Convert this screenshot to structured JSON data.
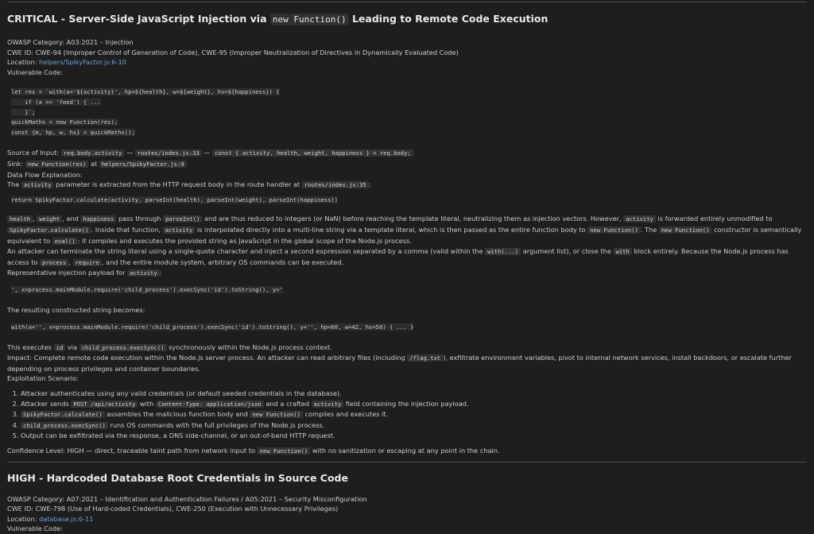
{
  "c": {
    "h_a": "CRITICAL - Server-Side JavaScript Injection via",
    "h_code": "new Function()",
    "h_b": "Leading to Remote Code Execution",
    "owasp": "OWASP Category: A03:2021 – Injection",
    "cwe": "CWE ID: CWE-94 (Improper Control of Generation of Code), CWE-95 (Improper Neutralization of Directives in Dynamically Evaluated Code)",
    "loc_label": "Location:",
    "loc_link": "helpers/SpikyFactor.js:6-10",
    "vuln_label": "Vulnerable Code:",
    "code1": [
      "let res = `with(a='${activity}', hp=${health}, w=${weight}, hs=${happiness}) {",
      "    if (a == 'feed') { ...",
      "    }`;",
      "quickMaths = new Function(res);",
      "const {m, hp, w, hs} = quickMaths();"
    ],
    "src_label": "Source of Input:",
    "src_c1": "req.body.activity",
    "src_sep1": "—",
    "src_c2": "routes/index.js:33",
    "src_sep2": "—",
    "src_c3": "const { activity, health, weight, happiness } = req.body;",
    "sink_label": "Sink:",
    "sink_c1": "new Function(res)",
    "sink_at": "at",
    "sink_c2": "helpers/SpikyFactor.js:9",
    "dfe_label": "Data Flow Explanation:",
    "dfe_a": "The",
    "dfe_c1": "activity",
    "dfe_b": "parameter is extracted from the HTTP request body in the route handler at",
    "dfe_c2": "routes/index.js:35",
    "dfe_end": ":",
    "code2": "return SpikyFactor.calculate(activity, parseInt(health), parseInt(weight), parseInt(happiness))",
    "para1": {
      "c1": "health",
      "t1": ",",
      "c2": "weight",
      "t2": ", and",
      "c3": "happiness",
      "t3": "pass through",
      "c4": "parseInt()",
      "t4": "and are thus reduced to integers (or NaN) before reaching the template literal, neutralizing them as injection vectors. However,",
      "c5": "activity",
      "t5": "is forwarded entirely unmodified to",
      "c6": "SpikyFactor.calculate()",
      "t6": ". Inside that function,",
      "c7": "activity",
      "t7": "is interpolated directly into a multi-line string via a template literal, which is then passed as the entire function body to",
      "c8": "new Function()",
      "t8": ". The",
      "c9": "new Function()",
      "t9": "constructor is semantically equivalent to",
      "c10": "eval()",
      "t10": ": it compiles and executes the provided string as JavaScript in the global scope of the Node.js process."
    },
    "para2": {
      "t1": "An attacker can terminate the string literal using a single-quote character and inject a second expression separated by a comma (valid within the",
      "c1": "with(...)",
      "t2": "argument list), or close the",
      "c2": "with",
      "t3": "block entirely. Because the Node.js process has access to",
      "c3": "process",
      "t4": ",",
      "c4": "require",
      "t5": ", and the entire module system, arbitrary OS commands can be executed."
    },
    "payload_label": "Representative injection payload for",
    "payload_c": "activity",
    "payload_end": ":",
    "code3": "', x=process.mainModule.require('child_process').execSync('id').toString(), y='",
    "result_label": "The resulting constructed string becomes:",
    "code4": "with(a='', x=process.mainModule.require('child_process').execSync('id').toString(), y='', hp=60, w=42, hs=50) { ... }",
    "exec_a": "This executes",
    "exec_c1": "id",
    "exec_b": "via",
    "exec_c2": "child_process.execSync()",
    "exec_c": "synchronously within the Node.js process context.",
    "impact_a": "Impact: Complete remote code execution within the Node.js server process. An attacker can read arbitrary files (including",
    "impact_c": "/flag.txt",
    "impact_b": "), exfiltrate environment variables, pivot to internal network services, install backdoors, or escalate further depending on process privileges and container boundaries.",
    "scenario_label": "Exploitation Scenario:",
    "steps": {
      "s1": "Attacker authenticates using any valid credentials (or default seeded credentials in the database).",
      "s2a": "Attacker sends",
      "s2c1": "POST /api/activity",
      "s2b": "with",
      "s2c2": "Content-Type: application/json",
      "s2c": "and a crafted",
      "s2c3": "activity",
      "s2d": "field containing the injection payload.",
      "s3c1": "SpikyFactor.calculate()",
      "s3a": "assembles the malicious function body and",
      "s3c2": "new Function()",
      "s3b": "compiles and executes it.",
      "s4c": "child_process.execSync()",
      "s4a": "runs OS commands with the full privileges of the Node.js process.",
      "s5": "Output can be exfiltrated via the response, a DNS side-channel, or an out-of-band HTTP request."
    },
    "conf_a": "Confidence Level: HIGH — direct, traceable taint path from network input to",
    "conf_c": "new Function()",
    "conf_b": "with no sanitization or escaping at any point in the chain."
  },
  "h": {
    "title": "HIGH - Hardcoded Database Root Credentials in Source Code",
    "owasp": "OWASP Category: A07:2021 – Identification and Authentication Failures / A05:2021 – Security Misconfiguration",
    "cwe": "CWE ID: CWE-798 (Use of Hard-coded Credentials), CWE-250 (Execution with Unnecessary Privileges)",
    "loc_label": "Location:",
    "loc_link": "database.js:6-11",
    "vuln_label": "Vulnerable Code:"
  }
}
